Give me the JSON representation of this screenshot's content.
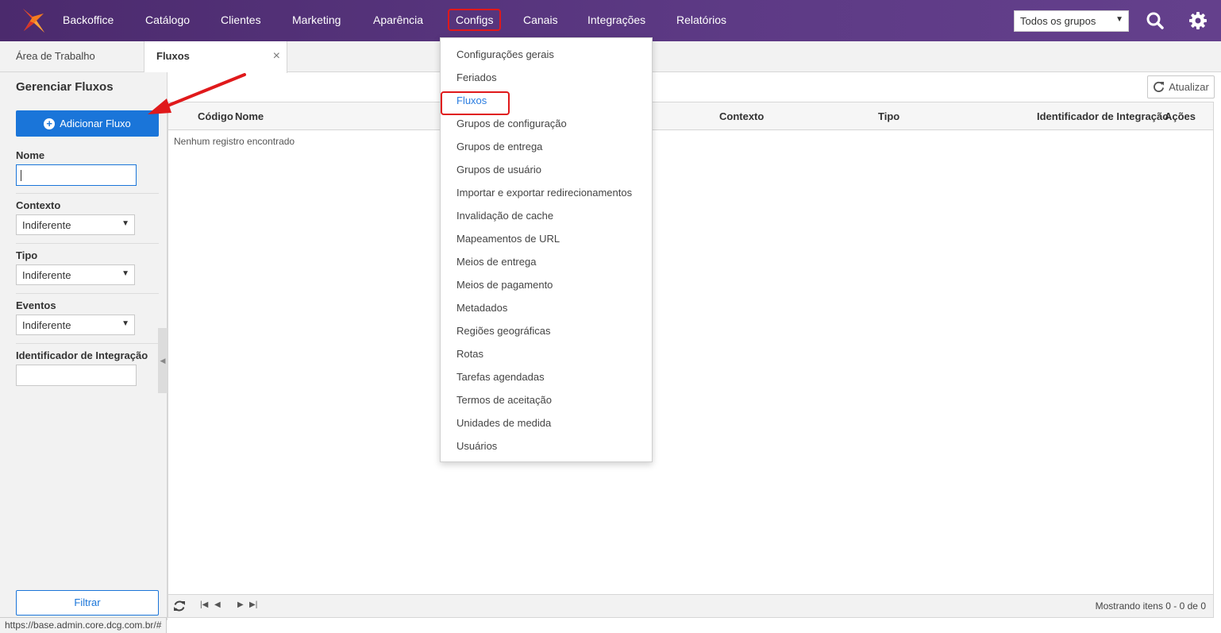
{
  "topbar": {
    "nav": [
      "Backoffice",
      "Catálogo",
      "Clientes",
      "Marketing",
      "Aparência",
      "Configs",
      "Canais",
      "Integrações",
      "Relatórios"
    ],
    "active": "Configs",
    "group_select": "Todos os grupos",
    "icons": [
      "search-icon",
      "gear-icon"
    ],
    "accent": "#5d3a85"
  },
  "tabs": {
    "home": "Área de Trabalho",
    "current": "Fluxos",
    "close": "×"
  },
  "sidebar": {
    "title": "Gerenciar Fluxos",
    "add_button": "Adicionar Fluxo",
    "filters": {
      "nome_label": "Nome",
      "nome_value": "",
      "contexto_label": "Contexto",
      "contexto_value": "Indiferente",
      "tipo_label": "Tipo",
      "tipo_value": "Indiferente",
      "eventos_label": "Eventos",
      "eventos_value": "Indiferente",
      "integracao_label": "Identificador de Integração",
      "integracao_value": ""
    },
    "filter_button": "Filtrar"
  },
  "main": {
    "refresh_button": "Atualizar",
    "columns": [
      "Código",
      "Nome",
      "Contexto",
      "Tipo",
      "Identificador de Integração",
      "Ações"
    ],
    "empty_message": "Nenhum registro encontrado",
    "pager_info": "Mostrando itens 0 - 0 de 0"
  },
  "configs_menu": {
    "items": [
      "Configurações gerais",
      "Feriados",
      "Fluxos",
      "Grupos de configuração",
      "Grupos de entrega",
      "Grupos de usuário",
      "Importar e exportar redirecionamentos",
      "Invalidação de cache",
      "Mapeamentos de URL",
      "Meios de entrega",
      "Meios de pagamento",
      "Metadados",
      "Regiões geográficas",
      "Rotas",
      "Tarefas agendadas",
      "Termos de aceitação",
      "Unidades de medida",
      "Usuários"
    ],
    "highlighted": "Fluxos",
    "highlight_color": "#2a7de1"
  },
  "statusbar": {
    "url": "https://base.admin.core.dcg.com.br/#"
  },
  "colors": {
    "primary_button": "#1a75d9",
    "annotation_red": "#e0191b"
  }
}
